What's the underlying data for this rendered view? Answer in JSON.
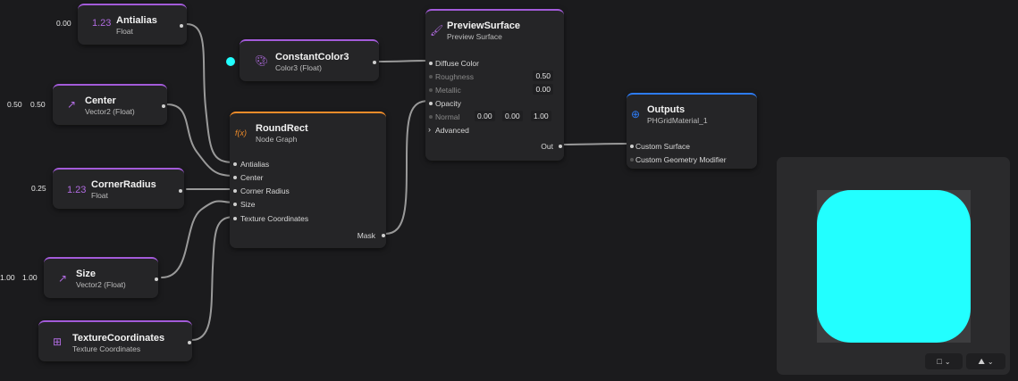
{
  "colors": {
    "cyan": "#22ffff",
    "purple": "#a35bd9",
    "orange": "#f08c2a",
    "blue": "#2d7cf6"
  },
  "nodes": {
    "antialias": {
      "title": "Antialias",
      "subtitle": "Float",
      "badge": "1.23",
      "value": "0.00"
    },
    "center": {
      "title": "Center",
      "subtitle": "Vector2 (Float)",
      "icon": "arrow-up-right-icon",
      "values": [
        "0.50",
        "0.50"
      ]
    },
    "corner_radius": {
      "title": "CornerRadius",
      "subtitle": "Float",
      "badge": "1.23",
      "value": "0.25"
    },
    "size": {
      "title": "Size",
      "subtitle": "Vector2 (Float)",
      "icon": "arrow-up-right-icon",
      "values": [
        "1.00",
        "1.00"
      ]
    },
    "texture_coordinates": {
      "title": "TextureCoordinates",
      "subtitle": "Texture Coordinates",
      "icon": "grid-square-icon"
    },
    "constant_color": {
      "title": "ConstantColor3",
      "subtitle": "Color3 (Float)",
      "icon": "palette-icon",
      "swatch": "#22ffff"
    },
    "round_rect": {
      "title": "RoundRect",
      "subtitle": "Node Graph",
      "icon_text": "f(x)",
      "inputs": [
        "Antialias",
        "Center",
        "Corner Radius",
        "Size",
        "Texture Coordinates"
      ],
      "output": "Mask"
    },
    "preview_surface": {
      "title": "PreviewSurface",
      "subtitle": "Preview Surface",
      "icon": "brush-icon",
      "diffuse": "Diffuse Color",
      "roughness": {
        "label": "Roughness",
        "value": "0.50"
      },
      "metallic": {
        "label": "Metallic",
        "value": "0.00"
      },
      "opacity": "Opacity",
      "normal": {
        "label": "Normal",
        "values": [
          "0.00",
          "0.00",
          "1.00"
        ]
      },
      "advanced": "Advanced",
      "output": "Out"
    },
    "outputs": {
      "title": "Outputs",
      "subtitle": "PHGridMaterial_1",
      "icon": "arrow-circle-icon",
      "inputs": [
        "Custom Surface",
        "Custom Geometry Modifier"
      ]
    }
  },
  "preview": {
    "shape_color": "#22ffff",
    "shape_icon": "square-icon",
    "env_icon": "mountains-icon"
  }
}
